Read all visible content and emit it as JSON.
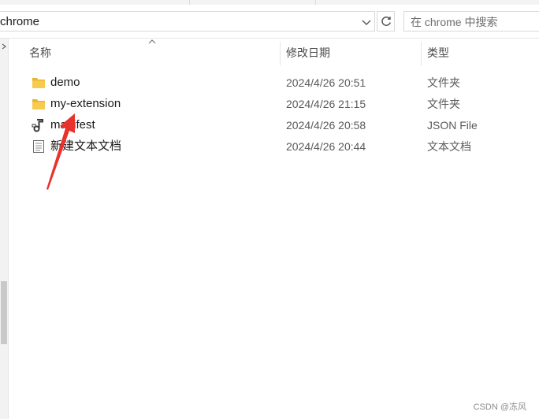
{
  "address": {
    "path": "chrome"
  },
  "search": {
    "placeholder": "在 chrome 中搜索"
  },
  "columns": {
    "name": "名称",
    "date": "修改日期",
    "type": "类型"
  },
  "files": [
    {
      "icon": "folder-icon",
      "name": "demo",
      "date": "2024/4/26 20:51",
      "type": "文件夹"
    },
    {
      "icon": "folder-icon",
      "name": "my-extension",
      "date": "2024/4/26 21:15",
      "type": "文件夹"
    },
    {
      "icon": "json-file-icon",
      "name": "manifest",
      "date": "2024/4/26 20:58",
      "type": "JSON File"
    },
    {
      "icon": "text-document-icon",
      "name": "新建文本文档",
      "date": "2024/4/26 20:44",
      "type": "文本文档"
    }
  ],
  "watermark": "CSDN @冻风",
  "colors": {
    "annotation_arrow": "#e8322b",
    "folder": "#f5c542"
  }
}
